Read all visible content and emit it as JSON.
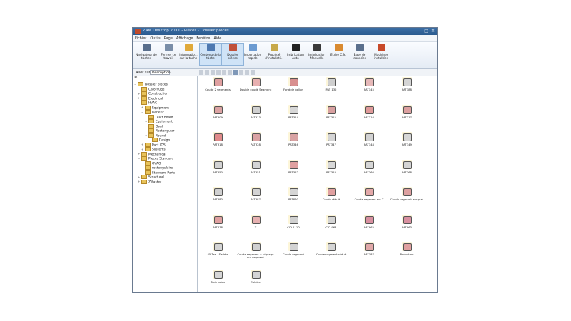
{
  "window": {
    "title": "ZAM Desktop 2011 - Pièces - Dossier pièces"
  },
  "menu": [
    "Fichier",
    "Outils",
    "Page",
    "Affichage",
    "Fenêtre",
    "Aide"
  ],
  "ribbon": [
    {
      "label": "Navigateur de tâches",
      "color": "#5a6f8c",
      "selected": false
    },
    {
      "label": "Fermer ce travail",
      "color": "#7a8ea8",
      "selected": false
    },
    {
      "label": "Informatio... sur la tâche",
      "color": "#e0a93a",
      "selected": false
    },
    {
      "label": "Contenu de la tâche",
      "color": "#4d78b0",
      "selected": true
    },
    {
      "label": "Dossier pièces",
      "color": "#c0503a",
      "selected": true
    },
    {
      "label": "Importation rapide",
      "color": "#6c9bd1",
      "selected": false
    },
    {
      "label": "Procédé d'installati...",
      "color": "#c7a94a",
      "selected": false
    },
    {
      "label": "Imbrication Auto",
      "color": "#222222",
      "selected": false
    },
    {
      "label": "Imbrication Manuelle",
      "color": "#3a3a3a",
      "selected": false
    },
    {
      "label": "Ecrire C.N.",
      "color": "#d98a30",
      "selected": false
    },
    {
      "label": "Base de données",
      "color": "#5a6f8c",
      "selected": false
    },
    {
      "label": "Machines installées",
      "color": "#c84a2a",
      "selected": false
    }
  ],
  "filter": {
    "label": "Aller sur",
    "value": "Description"
  },
  "tree": [
    {
      "label": "Dossier pièces",
      "depth": 0,
      "exp": "−"
    },
    {
      "label": "Calorifuge",
      "depth": 1,
      "exp": ""
    },
    {
      "label": "Construction",
      "depth": 1,
      "exp": "+"
    },
    {
      "label": "Electrical",
      "depth": 1,
      "exp": "+"
    },
    {
      "label": "HVAC",
      "depth": 1,
      "exp": "−"
    },
    {
      "label": "Equipment",
      "depth": 2,
      "exp": "+"
    },
    {
      "label": "Generic",
      "depth": 2,
      "exp": "−"
    },
    {
      "label": "Duct Board",
      "depth": 3,
      "exp": ""
    },
    {
      "label": "Equipment",
      "depth": 3,
      "exp": "+"
    },
    {
      "label": "Oval",
      "depth": 3,
      "exp": ""
    },
    {
      "label": "Rectangular",
      "depth": 3,
      "exp": ""
    },
    {
      "label": "Round",
      "depth": 3,
      "exp": "−"
    },
    {
      "label": "Design",
      "depth": 4,
      "exp": ""
    },
    {
      "label": "Pact (QS)",
      "depth": 2,
      "exp": "+"
    },
    {
      "label": "Systems",
      "depth": 2,
      "exp": "+"
    },
    {
      "label": "Mechanical",
      "depth": 1,
      "exp": "+"
    },
    {
      "label": "Pieces Standard",
      "depth": 1,
      "exp": "−"
    },
    {
      "label": "OVAO",
      "depth": 2,
      "exp": ""
    },
    {
      "label": "rectangulaire",
      "depth": 2,
      "exp": ""
    },
    {
      "label": "Standard Parts",
      "depth": 2,
      "exp": ""
    },
    {
      "label": "Structural",
      "depth": 1,
      "exp": "+"
    },
    {
      "label": "ZMaster",
      "depth": 1,
      "exp": "+"
    }
  ],
  "parts": [
    {
      "name": "Coude 2 segments",
      "color": "#e0a0a0"
    },
    {
      "name": "Double coudé Segment",
      "color": "#e8b0b0"
    },
    {
      "name": "Fond de ballon",
      "color": "#d98f8f"
    },
    {
      "name": "PAT 132",
      "color": "#cfcfcf"
    },
    {
      "name": "PAT145",
      "color": "#e6b8b8"
    },
    {
      "name": "PAT188",
      "color": "#d5d5d5"
    },
    {
      "name": "PAT309",
      "color": "#dca3a3"
    },
    {
      "name": "PAT313",
      "color": "#d0d0d0"
    },
    {
      "name": "PAT314",
      "color": "#d7d7d7"
    },
    {
      "name": "PAT315",
      "color": "#d8a0a0"
    },
    {
      "name": "PAT316",
      "color": "#e09a9a"
    },
    {
      "name": "PAT317",
      "color": "#dca0a0"
    },
    {
      "name": "PAT318",
      "color": "#e08a8a"
    },
    {
      "name": "PAT328",
      "color": "#dba3a3"
    },
    {
      "name": "PAT346",
      "color": "#d9a3a3"
    },
    {
      "name": "PAT347",
      "color": "#d4d4d4"
    },
    {
      "name": "PAT348",
      "color": "#d2d2d2"
    },
    {
      "name": "PAT349",
      "color": "#d6d6d6"
    },
    {
      "name": "PAT350",
      "color": "#d3d3d3"
    },
    {
      "name": "PAT351",
      "color": "#d5d5d5"
    },
    {
      "name": "PAT352",
      "color": "#e0a0a0"
    },
    {
      "name": "PAT353",
      "color": "#d8d8d8"
    },
    {
      "name": "PAT366",
      "color": "#d6d6d6"
    },
    {
      "name": "PAT368",
      "color": "#d4d4d4"
    },
    {
      "name": "PAT380",
      "color": "#d0d0d0"
    },
    {
      "name": "PAT387",
      "color": "#d3d3d3"
    },
    {
      "name": "PAT860",
      "color": "#d5d5d5"
    },
    {
      "name": "Coude réduit",
      "color": "#e0a0a0"
    },
    {
      "name": "Coude segment sur T",
      "color": "#e3a8a8"
    },
    {
      "name": "Coude segment avc plat",
      "color": "#dda0a0"
    },
    {
      "name": "PAT878",
      "color": "#e0a0a0"
    },
    {
      "name": "T",
      "color": "#e6b0b0"
    },
    {
      "name": "CID 1110",
      "color": "#d0d0d0"
    },
    {
      "name": "CID 964",
      "color": "#d4d4d4"
    },
    {
      "name": "PAT962",
      "color": "#d890a0"
    },
    {
      "name": "PAT963",
      "color": "#d890a0"
    },
    {
      "name": "45 Tee - Saddle",
      "color": "#d4d4d4"
    },
    {
      "name": "Coude segment + piquage sur segment",
      "color": "#d0d0d0"
    },
    {
      "name": "Coude segment",
      "color": "#d3d3d3"
    },
    {
      "name": "Coude segment réduit",
      "color": "#d5d5d5"
    },
    {
      "name": "PAT187",
      "color": "#e0a8a8"
    },
    {
      "name": "Réduction",
      "color": "#e0a0a0"
    },
    {
      "name": "Trois voies",
      "color": "#d6d6d6"
    },
    {
      "name": "Culotte",
      "color": "#d4d4d4"
    }
  ]
}
